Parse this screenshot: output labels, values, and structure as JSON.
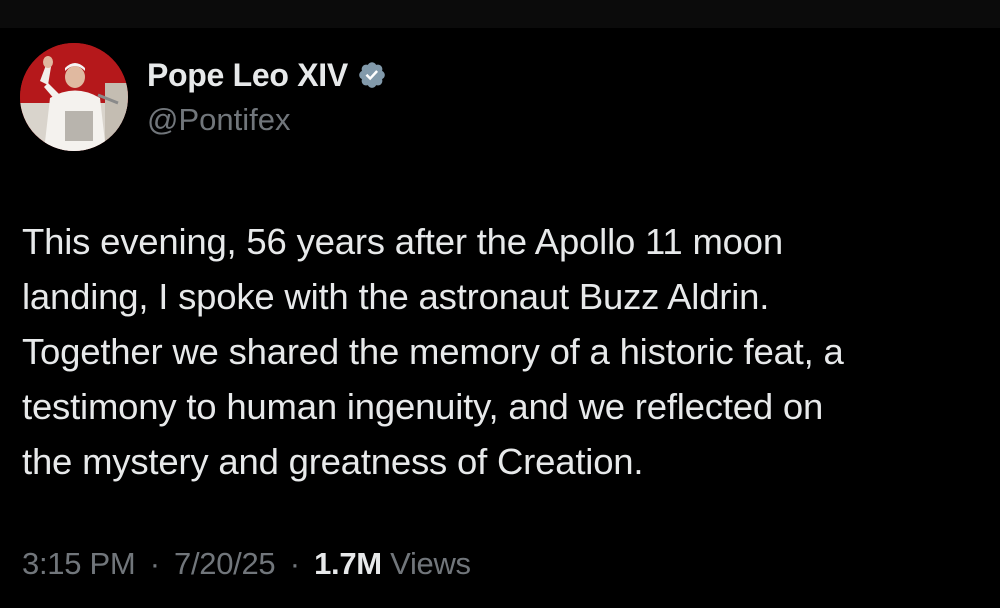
{
  "author": {
    "display_name": "Pope Leo XIV",
    "handle": "@Pontifex",
    "verified_badge_color": "#829aab",
    "avatar_background": "#b5181b"
  },
  "tweet": {
    "text_lines": [
      "This evening, 56 years after the Apollo 11 moon",
      "landing, I spoke with the astronaut Buzz Aldrin.",
      "Together we shared the memory of a historic feat, a",
      "testimony to human ingenuity, and we reflected on",
      "the mystery and greatness of Creation."
    ]
  },
  "meta": {
    "time": "3:15 PM",
    "separator": "·",
    "date": "7/20/25",
    "views_count": "1.7M",
    "views_label": "Views"
  },
  "colors": {
    "background": "#000000",
    "primary_text": "#e7e9ea",
    "secondary_text": "#71767b"
  }
}
